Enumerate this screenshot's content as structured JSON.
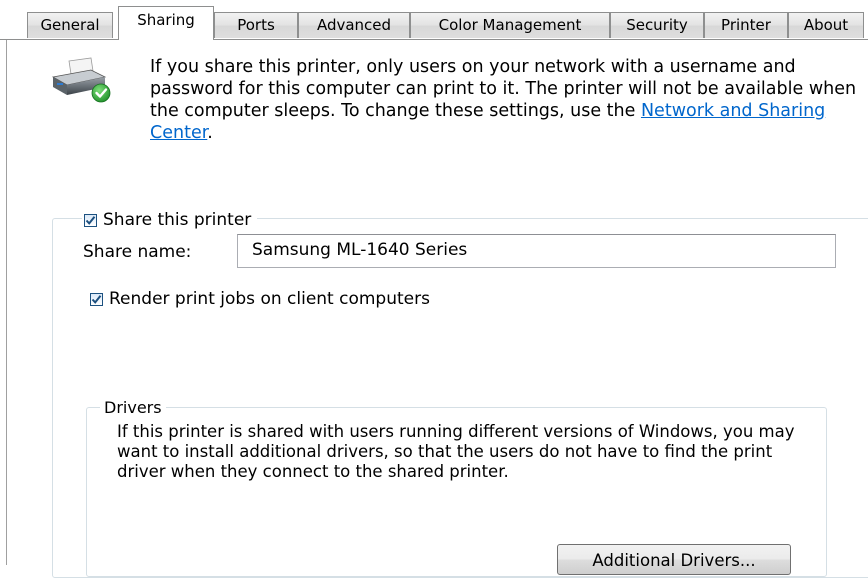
{
  "tabs": [
    "General",
    "Sharing",
    "Ports",
    "Advanced",
    "Color Management",
    "Security",
    "Printer",
    "About"
  ],
  "active_tab": "Sharing",
  "intro": {
    "text": "If you share this printer, only users on your network with a username and password for this computer can print to it. The printer will not be available when the computer sleeps. To change these settings, use the ",
    "link": "Network and Sharing Center",
    "end": "."
  },
  "share": {
    "checkbox_label": "Share this printer",
    "checked": true,
    "name_label": "Share name:",
    "name_value": "Samsung ML-1640 Series",
    "render_label": "Render print jobs on client computers",
    "render_checked": true
  },
  "drivers": {
    "legend": "Drivers",
    "text": "If this printer is shared with users running different versions of Windows, you may want to install additional drivers, so that the users do not have to find the print driver when they connect to the shared printer.",
    "button": "Additional Drivers..."
  },
  "colors": {
    "link": "#0066cc",
    "check": "#1c4f7e",
    "border": "#d5dfe5"
  },
  "icons": {
    "printer": "printer-shared-icon",
    "check": "checkmark-icon"
  }
}
